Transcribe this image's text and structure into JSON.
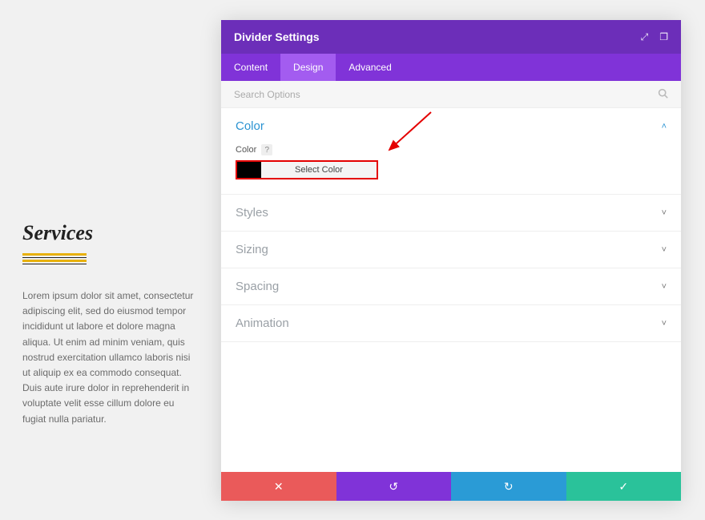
{
  "left": {
    "title": "Services",
    "body": "Lorem ipsum dolor sit amet, consectetur adipiscing elit, sed do eiusmod tempor incididunt ut labore et dolore magna aliqua. Ut enim ad minim veniam, quis nostrud exercitation ullamco laboris nisi ut aliquip ex ea commodo consequat. Duis aute irure dolor in reprehenderit in voluptate velit esse cillum dolore eu fugiat nulla pariatur."
  },
  "modal": {
    "title": "Divider Settings",
    "tabs": {
      "content": "Content",
      "design": "Design",
      "advanced": "Advanced"
    },
    "search_placeholder": "Search Options",
    "sections": {
      "color": {
        "heading": "Color",
        "field_label": "Color",
        "help": "?",
        "button_label": "Select Color",
        "swatch_hex": "#000000"
      },
      "styles": "Styles",
      "sizing": "Sizing",
      "spacing": "Spacing",
      "animation": "Animation"
    },
    "footer": {
      "cancel_icon": "✕",
      "undo_icon": "↺",
      "redo_icon": "↻",
      "save_icon": "✓"
    },
    "header_icons": {
      "expand": "⤢",
      "help": "❐"
    }
  }
}
